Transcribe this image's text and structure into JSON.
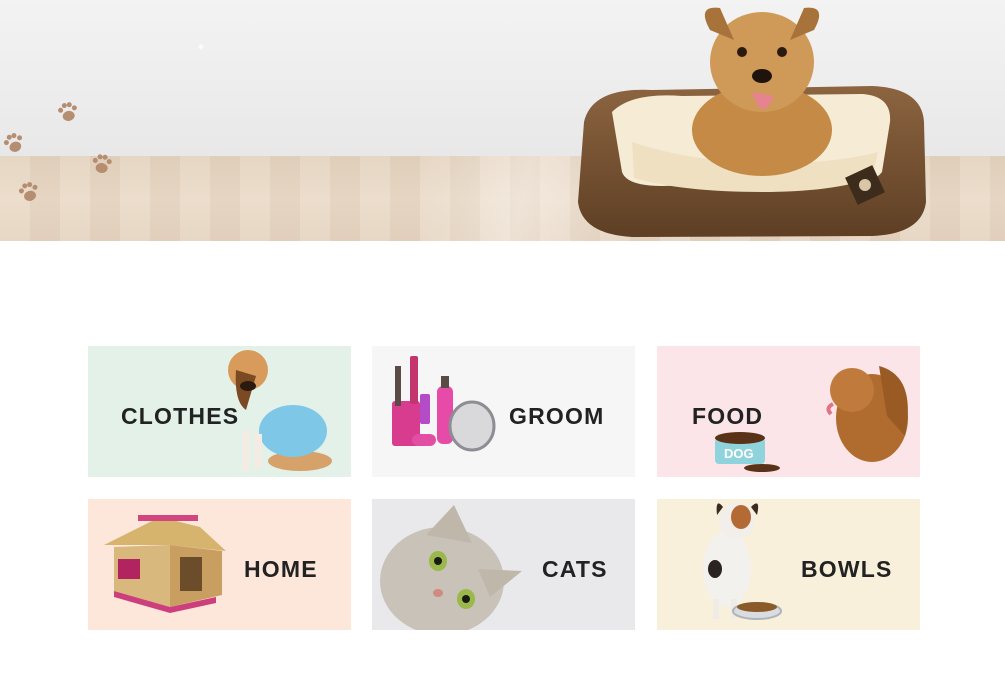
{
  "hero": {
    "background": "#ececec",
    "floor_color": "#e6d5c1",
    "paw_color": "#b58d70",
    "bed_color": "#7a5534",
    "dog_color": "#c8924e"
  },
  "categories": [
    {
      "label": "CLOTHES",
      "bg": "#e3f1e9"
    },
    {
      "label": "GROOM",
      "bg": "#f6f6f6"
    },
    {
      "label": "FOOD",
      "bg": "#fce5e8"
    },
    {
      "label": "HOME",
      "bg": "#fde7da"
    },
    {
      "label": "CATS",
      "bg": "#e9e9ec"
    },
    {
      "label": "BOWLS",
      "bg": "#f8f0da"
    }
  ],
  "bowl_text": "DOG"
}
